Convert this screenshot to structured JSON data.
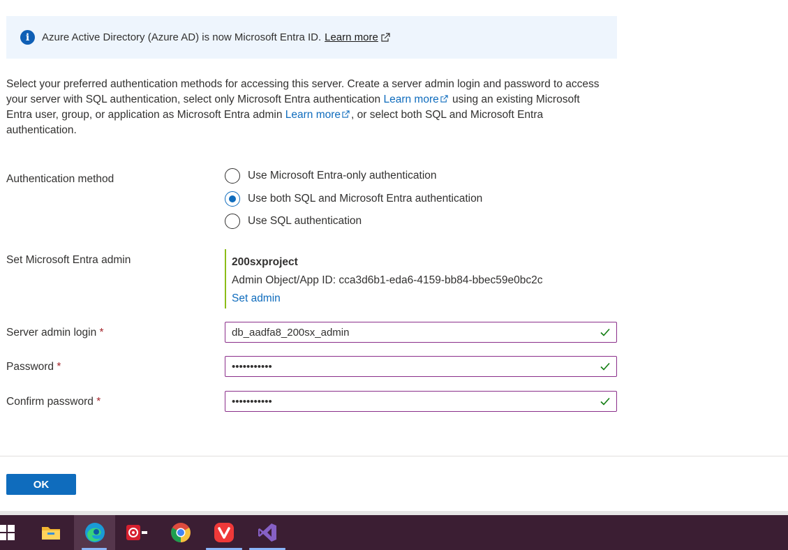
{
  "banner": {
    "text": "Azure Active Directory (Azure AD) is now Microsoft Entra ID.",
    "link": "Learn more"
  },
  "description": {
    "part1": "Select your preferred authentication methods for accessing this server. Create a server admin login and password to access your server with SQL authentication, select only Microsoft Entra authentication ",
    "link1": "Learn more",
    "part2": " using an existing Microsoft Entra user, group, or application as Microsoft Entra admin ",
    "link2": "Learn more",
    "part3": ", or select both SQL and Microsoft Entra authentication."
  },
  "auth": {
    "label": "Authentication method",
    "options": [
      {
        "label": "Use Microsoft Entra-only authentication",
        "selected": false
      },
      {
        "label": "Use both SQL and Microsoft Entra authentication",
        "selected": true
      },
      {
        "label": "Use SQL authentication",
        "selected": false
      }
    ]
  },
  "entra_admin": {
    "label": "Set Microsoft Entra admin",
    "name": "200sxproject",
    "id_text": "Admin Object/App ID: cca3d6b1-eda6-4159-bb84-bbec59e0bc2c",
    "link": "Set admin"
  },
  "fields": {
    "login_label": "Server admin login",
    "login_value": "db_aadfa8_200sx_admin",
    "password_label": "Password",
    "password_value": "•••••••••••",
    "confirm_label": "Confirm password",
    "confirm_value": "•••••••••••",
    "required_mark": "*"
  },
  "footer": {
    "ok_label": "OK"
  },
  "taskbar": {
    "items": [
      "windows-start",
      "file-explorer",
      "edge",
      "app-red",
      "chrome",
      "vivaldi",
      "visual-studio"
    ]
  },
  "colors": {
    "accent": "#0f6cbd",
    "valid_border": "#8a2e8a",
    "check": "#107c10",
    "admin_bar": "#8cbd18",
    "taskbar": "#3b1e33"
  }
}
